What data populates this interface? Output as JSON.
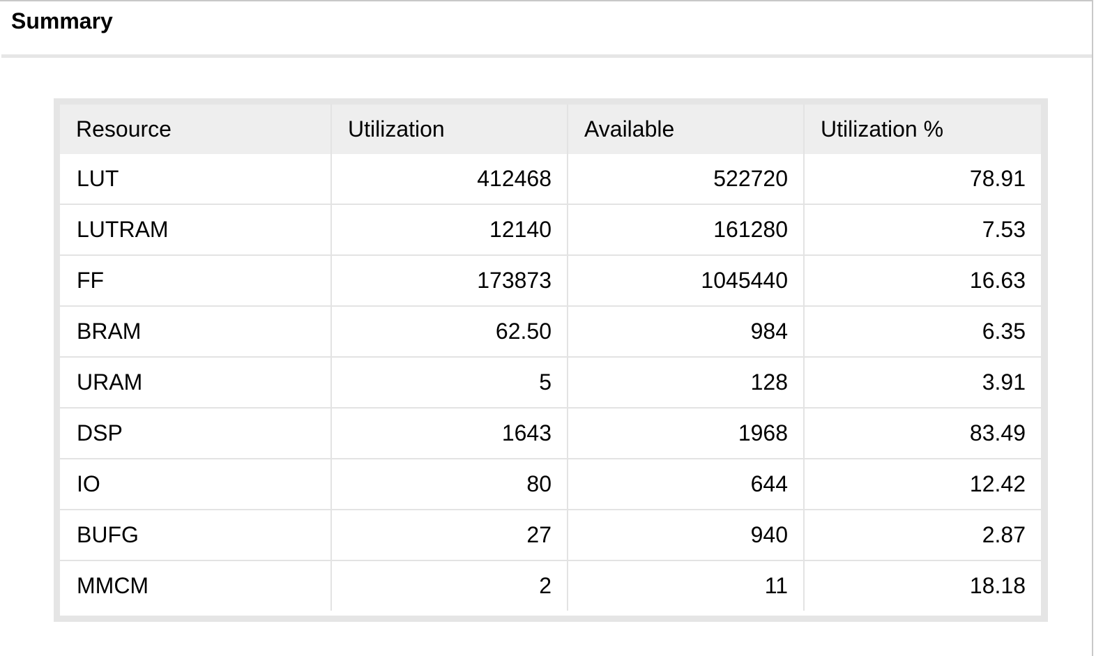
{
  "title": "Summary",
  "table": {
    "headers": [
      "Resource",
      "Utilization",
      "Available",
      "Utilization %"
    ],
    "rows": [
      [
        "LUT",
        "412468",
        "522720",
        "78.91"
      ],
      [
        "LUTRAM",
        "12140",
        "161280",
        "7.53"
      ],
      [
        "FF",
        "173873",
        "1045440",
        "16.63"
      ],
      [
        "BRAM",
        "62.50",
        "984",
        "6.35"
      ],
      [
        "URAM",
        "5",
        "128",
        "3.91"
      ],
      [
        "DSP",
        "1643",
        "1968",
        "83.49"
      ],
      [
        "IO",
        "80",
        "644",
        "12.42"
      ],
      [
        "BUFG",
        "27",
        "940",
        "2.87"
      ],
      [
        "MMCM",
        "2",
        "11",
        "18.18"
      ]
    ]
  }
}
